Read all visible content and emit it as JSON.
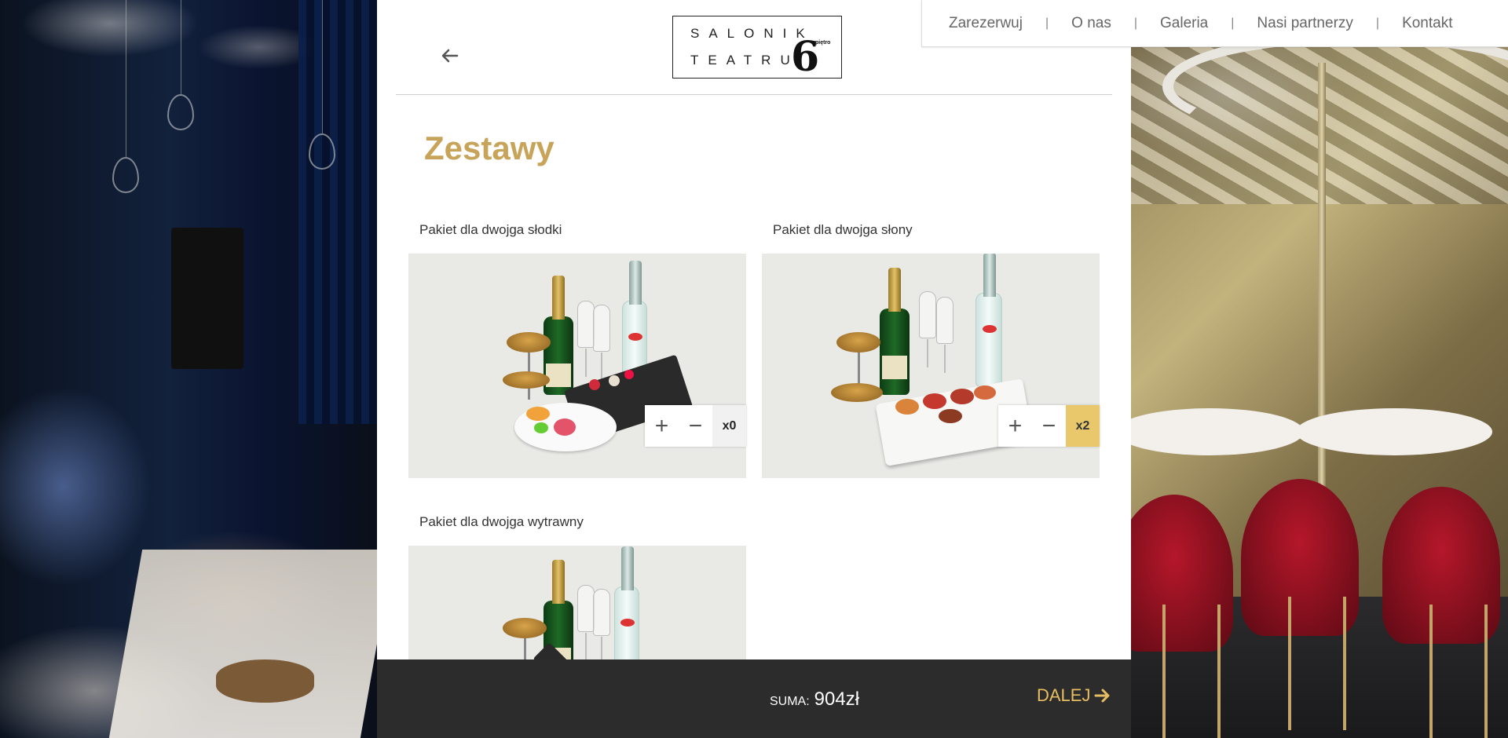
{
  "nav": {
    "items": [
      "Zarezerwuj",
      "O nas",
      "Galeria",
      "Nasi partnerzy",
      "Kontakt"
    ],
    "separator": "|"
  },
  "logo": {
    "line1": "SALONIK",
    "line2": "TEATRU",
    "number": "6",
    "floor": "piętro"
  },
  "page": {
    "title": "Zestawy"
  },
  "products": [
    {
      "title": "Pakiet dla dwojga słodki",
      "count": "x0",
      "active": false
    },
    {
      "title": "Pakiet dla dwojga słony",
      "count": "x2",
      "active": true
    },
    {
      "title": "Pakiet dla dwojga wytrawny",
      "count": "",
      "active": false
    }
  ],
  "quantity": {
    "plus": "+",
    "minus": "−"
  },
  "footer": {
    "sum_label": "SUMA:",
    "sum_value": "904zł",
    "next_label": "DALEJ"
  },
  "colors": {
    "accent": "#c8a45a",
    "active_count": "#e9c86b",
    "footer_bg": "#2c2c2c",
    "next": "#e7bd62"
  },
  "icons": {
    "back": "arrow-left-icon",
    "next": "arrow-right-icon"
  }
}
